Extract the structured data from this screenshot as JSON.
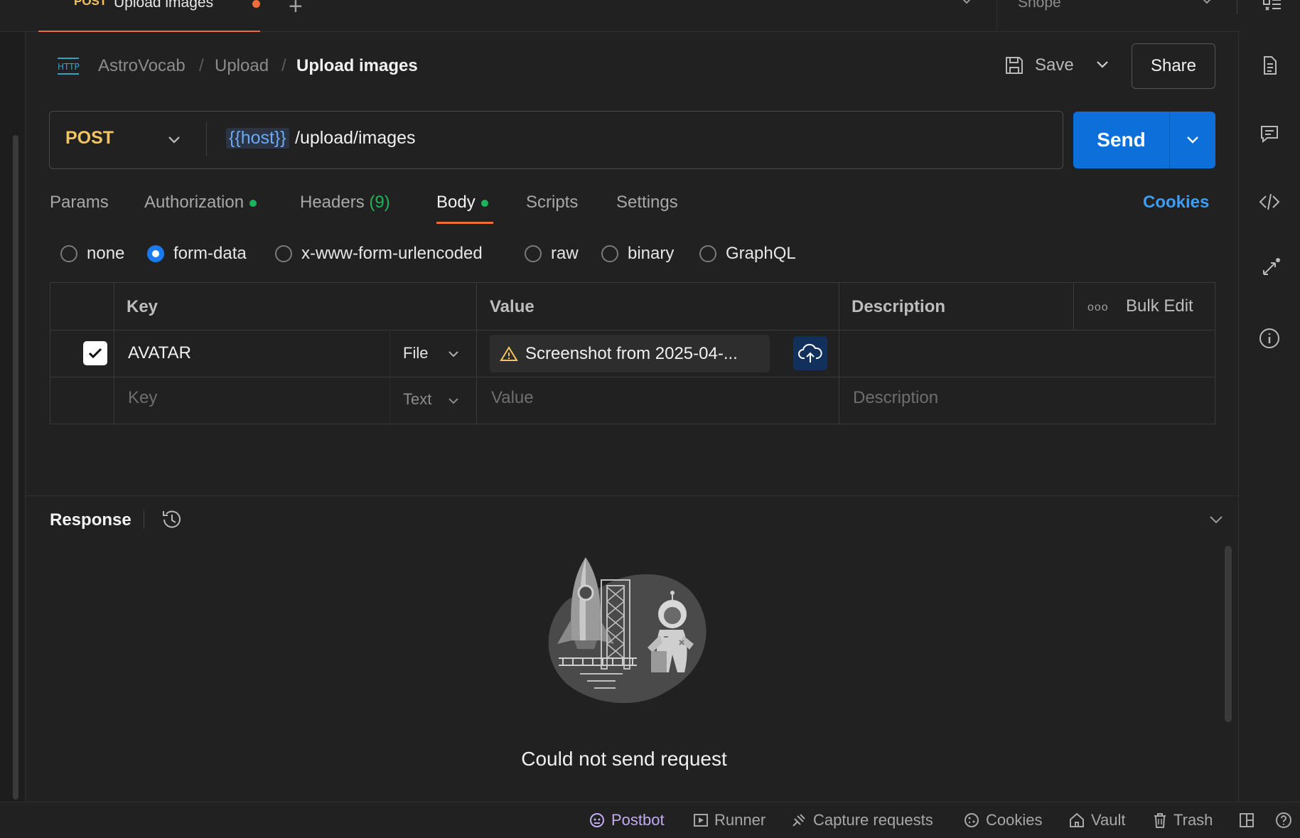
{
  "tab": {
    "method": "POST",
    "name": "Upload images"
  },
  "environment": {
    "name": "Shope"
  },
  "breadcrumb": {
    "collection": "AstroVocab",
    "folder": "Upload",
    "request": "Upload images",
    "separator": "/"
  },
  "actions": {
    "save_label": "Save",
    "share_label": "Share"
  },
  "request": {
    "method": "POST",
    "url_variable": "{{host}}",
    "url_path": "/upload/images",
    "send_label": "Send"
  },
  "request_tabs": {
    "params": "Params",
    "authorization": "Authorization",
    "headers": "Headers",
    "headers_count": "(9)",
    "body": "Body",
    "scripts": "Scripts",
    "settings": "Settings",
    "cookies": "Cookies"
  },
  "body_types": [
    "none",
    "form-data",
    "x-www-form-urlencoded",
    "raw",
    "binary",
    "GraphQL"
  ],
  "body_selected": "form-data",
  "table": {
    "headers": {
      "key": "Key",
      "value": "Value",
      "description": "Description",
      "bulk_edit": "Bulk Edit",
      "more": "ooo"
    },
    "rows": [
      {
        "key": "AVATAR",
        "type": "File",
        "value": "Screenshot from 2025-04-...",
        "checked": true
      }
    ],
    "empty_row": {
      "key": "Key",
      "type": "Text",
      "value": "Value",
      "description": "Description"
    }
  },
  "response": {
    "title": "Response",
    "message": "Could not send request"
  },
  "statusbar": {
    "postbot": "Postbot",
    "runner": "Runner",
    "capture": "Capture requests",
    "cookies": "Cookies",
    "vault": "Vault",
    "trash": "Trash"
  },
  "colors": {
    "accent": "#f26b3a",
    "send": "#0c6fda",
    "method": "#f3c562",
    "link": "#3e9cf2",
    "dot": "#1cb45a"
  }
}
